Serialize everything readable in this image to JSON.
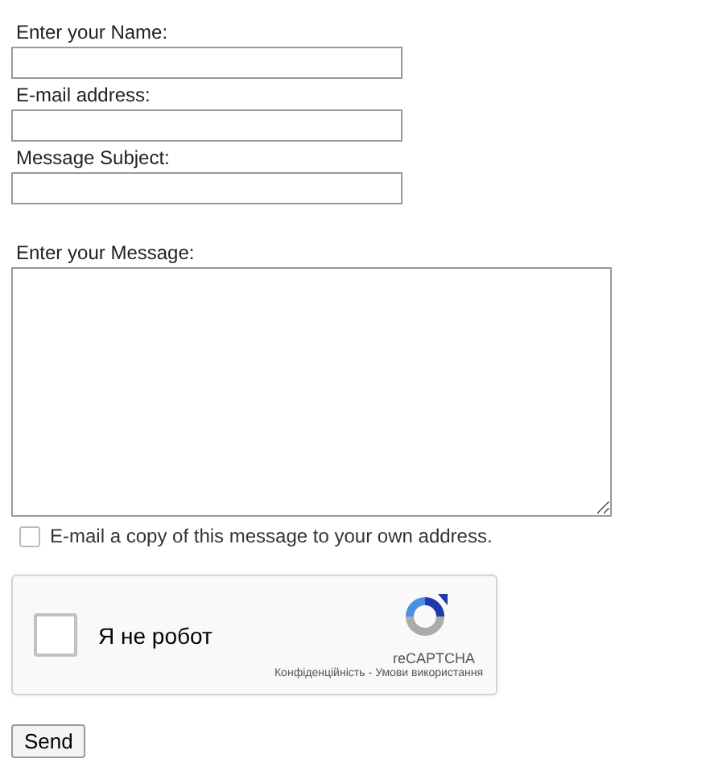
{
  "fields": [
    {
      "label": "Enter your Name:",
      "kind": "input"
    },
    {
      "label": "E-mail address:",
      "kind": "input"
    },
    {
      "label": "Message Subject:",
      "kind": "input"
    },
    {
      "label": "Enter your Message:",
      "kind": "textarea"
    }
  ],
  "copy_option": {
    "label": "E-mail a copy of this message to your own address.",
    "checked": false
  },
  "captcha": {
    "label": "Я не робот",
    "checked": false,
    "brand": "reCAPTCHA",
    "links": [
      "Конфіденційність",
      "Умови використання"
    ],
    "separator": "-"
  },
  "buttons": [
    "Send"
  ]
}
